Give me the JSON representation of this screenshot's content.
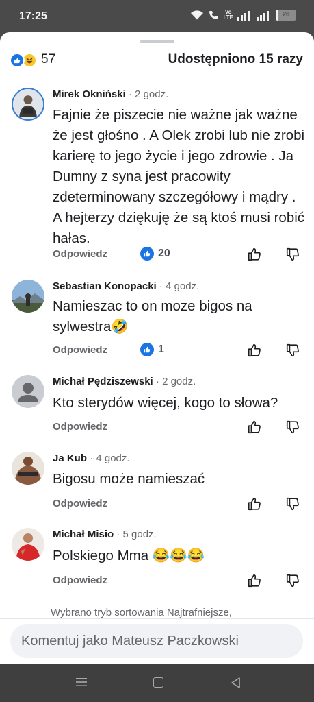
{
  "status_bar": {
    "time": "17:25",
    "volte_line1": "Vo",
    "volte_line2": "LTE",
    "battery": "26"
  },
  "post": {
    "reaction_count": "57",
    "shares": "Udostępniono 15 razy"
  },
  "comments": [
    {
      "author": "Mirek Okniński",
      "time": "· 2 godz.",
      "text": "Fajnie że piszecie nie ważne jak ważne że jest głośno . A Olek zrobi lub nie zrobi karierę to jego życie i jego zdrowie . Ja Dumny z syna jest pracowity zdeterminowany szczegółowy i mądry . A hejterzy dziękuję że są ktoś musi robić hałas.",
      "reply": "Odpowiedz",
      "likes": "20"
    },
    {
      "author": "Sebastian Konopacki",
      "time": "· 4 godz.",
      "text": "Namieszac to on moze bigos na sylwestra🤣",
      "reply": "Odpowiedz",
      "likes": "1"
    },
    {
      "author": "Michał Pędziszewski",
      "time": "· 2 godz.",
      "text": "Kto sterydów więcej, kogo to słowa?",
      "reply": "Odpowiedz",
      "likes": ""
    },
    {
      "author": "Ja Kub",
      "time": "· 4 godz.",
      "text": "Bigosu może namieszać",
      "reply": "Odpowiedz",
      "likes": ""
    },
    {
      "author": "Michał Misio",
      "time": "· 5 godz.",
      "text": "Polskiego Mma 😂😂😂",
      "reply": "Odpowiedz",
      "likes": ""
    }
  ],
  "sort_note": "Wybrano tryb sortowania Najtrafniejsze,",
  "comment_input": {
    "placeholder": "Komentuj jako Mateusz Paczkowski"
  },
  "colors": {
    "accent": "#1b74e4",
    "text": "#1c1e21",
    "muted": "#65676b"
  }
}
